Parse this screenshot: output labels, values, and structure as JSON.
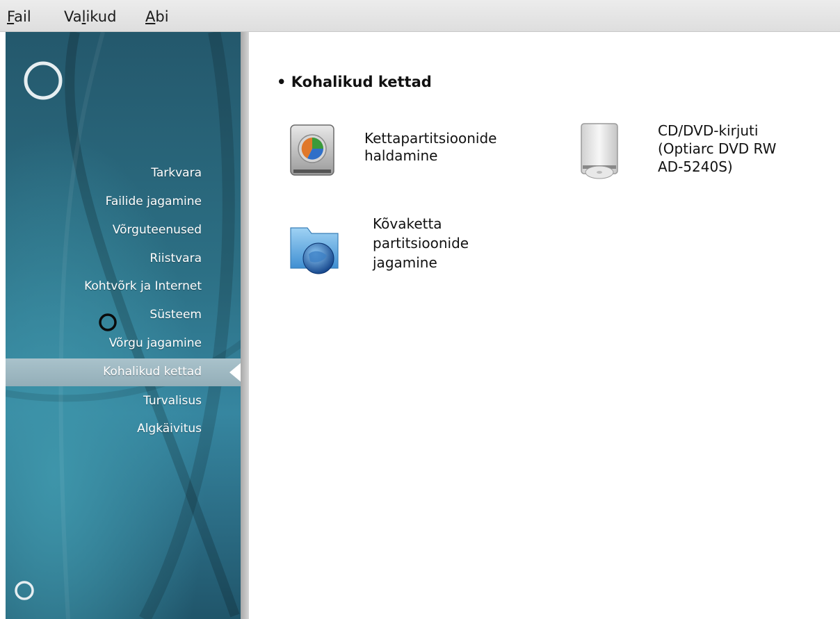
{
  "menubar": {
    "items": [
      {
        "accel": "F",
        "rest": "ail"
      },
      {
        "pre": "Va",
        "accel": "l",
        "rest": "ikud"
      },
      {
        "accel": "A",
        "rest": "bi"
      }
    ]
  },
  "sidebar": {
    "items": [
      {
        "label": "Tarkvara"
      },
      {
        "label": "Failide jagamine"
      },
      {
        "label": "Võrguteenused"
      },
      {
        "label": "Riistvara"
      },
      {
        "label": "Kohtvõrk ja Internet"
      },
      {
        "label": "Süsteem"
      },
      {
        "label": "Võrgu jagamine"
      },
      {
        "label": "Kohalikud kettad",
        "selected": true
      },
      {
        "label": "Turvalisus"
      },
      {
        "label": "Algkäivitus"
      }
    ]
  },
  "main": {
    "section_title": "Kohalikud kettad",
    "tiles": [
      {
        "icon": "hard-disk-icon",
        "line1": "Kettapartitsioonide",
        "line2": "haldamine"
      },
      {
        "icon": "optical-drive-icon",
        "line1": "CD/DVD-kirjuti",
        "line2": "(Optiarc DVD RW",
        "line3": "AD-5240S)"
      },
      {
        "icon": "network-folder-icon",
        "line1": "Kõvaketta",
        "line2": "partitsioonide",
        "line3": "jagamine"
      }
    ]
  },
  "colors": {
    "sidebar_top": "#24586c",
    "sidebar_mid": "#3686a0",
    "selected_bg": "#a9c2cb",
    "text_dark": "#111111"
  }
}
